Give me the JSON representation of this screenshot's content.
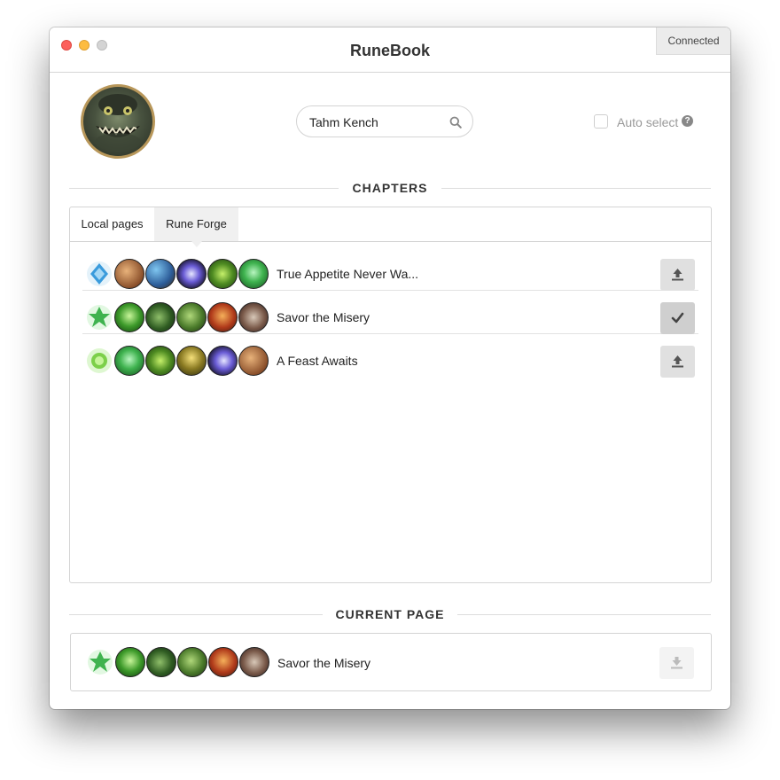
{
  "window": {
    "title": "RuneBook",
    "connection_status": "Connected"
  },
  "champion": {
    "search_value": "Tahm Kench",
    "search_icon": "search-icon"
  },
  "auto_select": {
    "label": "Auto select",
    "checked": false,
    "help_glyph": "?"
  },
  "sections": {
    "chapters": "CHAPTERS",
    "current_page": "CURRENT PAGE"
  },
  "tabs": [
    {
      "label": "Local pages",
      "active": false
    },
    {
      "label": "Rune Forge",
      "active": true
    }
  ],
  "pages": [
    {
      "name": "True Appetite Never Wa...",
      "action": "upload",
      "icon": "upload-icon"
    },
    {
      "name": "Savor the Misery",
      "action": "selected",
      "icon": "check-icon"
    },
    {
      "name": "A Feast Awaits",
      "action": "upload",
      "icon": "upload-icon"
    }
  ],
  "current_page": {
    "name": "Savor the Misery",
    "action_icon": "download-icon"
  },
  "colors": {
    "close": "#fc605c",
    "minimize": "#fdbc40",
    "zoom": "#d4d4d4",
    "precision_blue": "#3a9bdc",
    "resolve_green": "#3fb34f",
    "sorcery_purple": "#6a5cd6",
    "avatar_border": "#b8975a"
  }
}
